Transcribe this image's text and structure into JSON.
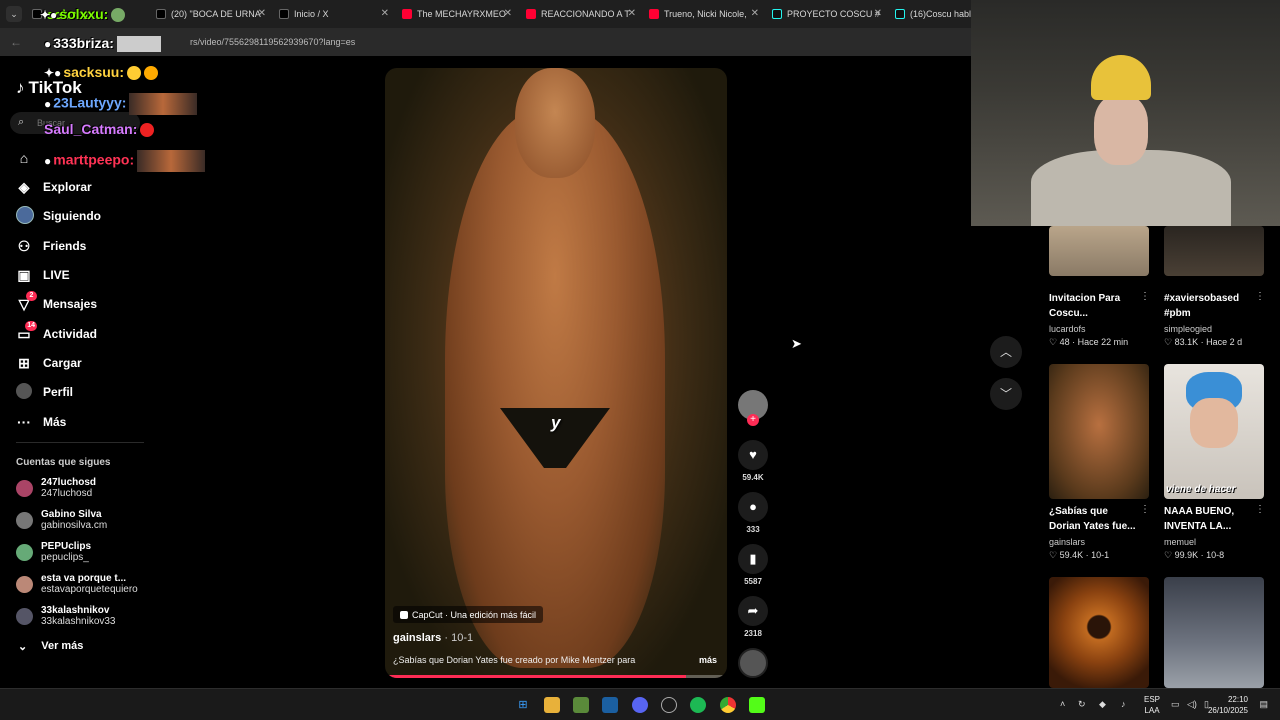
{
  "browser": {
    "tabs": [
      {
        "title": "solxxu:",
        "color": "#ffffff"
      },
      {
        "title": "(20) \"BOCA DE URNA",
        "color": "#ffffff"
      },
      {
        "title": "Inicio / X",
        "color": "#ffffff"
      },
      {
        "title": "The MECHAYRXMEO",
        "color": "#ff0033"
      },
      {
        "title": "REACCIONANDO A T",
        "color": "#ff0033"
      },
      {
        "title": "Trueno, Nicki Nicole,",
        "color": "#ff0033"
      },
      {
        "title": "PROYECTO COSCU #",
        "color": "#25f4ee"
      },
      {
        "title": "(16)Coscu habla d",
        "color": "#25f4ee"
      }
    ],
    "url": "rs/video/7556298119562939670?lang=es"
  },
  "chat": [
    {
      "user": "solxxu:",
      "color": "#7cfc00"
    },
    {
      "user": "333briza:",
      "color": "#ffffff"
    },
    {
      "user": "sacksuu:",
      "color": "#ffd23f"
    },
    {
      "user": "23Lautyyy:",
      "color": "#6ea8ff"
    },
    {
      "user": "Saul_Catman:",
      "color": "#d77bff"
    },
    {
      "user": "marttpeepo:",
      "color": "#ff3355"
    }
  ],
  "sidebar": {
    "logo": "TikTok",
    "search_placeholder": "Buscar",
    "items": [
      {
        "label": "",
        "icon": "home-icon"
      },
      {
        "label": "Explorar",
        "icon": "compass-icon"
      },
      {
        "label": "Siguiendo",
        "icon": "following-icon"
      },
      {
        "label": "Friends",
        "icon": "friends-icon"
      },
      {
        "label": "LIVE",
        "icon": "live-icon"
      },
      {
        "label": "Mensajes",
        "icon": "messages-icon",
        "badge": "2"
      },
      {
        "label": "Actividad",
        "icon": "activity-icon",
        "badge": "14"
      },
      {
        "label": "Cargar",
        "icon": "upload-icon"
      },
      {
        "label": "Perfil",
        "icon": "profile-icon"
      },
      {
        "label": "Más",
        "icon": "more-icon"
      }
    ],
    "following_title": "Cuentas que sigues",
    "accounts": [
      {
        "name": "247luchosd",
        "handle": "247luchosd"
      },
      {
        "name": "Gabino Silva",
        "handle": "gabinosilva.cm"
      },
      {
        "name": "PEPUclips",
        "handle": "pepuclips_"
      },
      {
        "name": "esta va porque t...",
        "handle": "estavaporquetequiero"
      },
      {
        "name": "33kalashnikov",
        "handle": "33kalashnikov33"
      }
    ],
    "see_more": "Ver más"
  },
  "video": {
    "caption_word": "y",
    "capcut_label": "CapCut · Una edición más fácil",
    "author": "gainslars",
    "date": "· 10-1",
    "description": "¿Sabías que Dorian Yates fue creado por Mike Mentzer para",
    "more": "más",
    "progress": 0.88
  },
  "actions": {
    "likes": "59.4K",
    "comments": "333",
    "saves": "5587",
    "shares": "2318"
  },
  "recommended": [
    {
      "title": "Invitacion Para Coscu...",
      "author": "lucardofs",
      "likes": "48",
      "time": "Hace 22 min",
      "overlay": ""
    },
    {
      "title": "#xaviersobased #pbm",
      "author": "simpleogied",
      "likes": "83.1K",
      "time": "Hace 2 d",
      "overlay": ""
    },
    {
      "title": "¿Sabías que Dorian Yates fue...",
      "author": "gainslars",
      "likes": "59.4K",
      "time": "10-1",
      "overlay": ""
    },
    {
      "title": "NAAA BUENO, INVENTA LA...",
      "author": "memuel",
      "likes": "99.9K",
      "time": "10-8",
      "overlay": "viene de hacer"
    }
  ],
  "taskbar": {
    "lang_top": "ESP",
    "lang_bottom": "LAA",
    "time": "22:10",
    "date": "26/10/2025"
  },
  "colors": {
    "accent": "#fe2c55",
    "bg": "#000000"
  }
}
